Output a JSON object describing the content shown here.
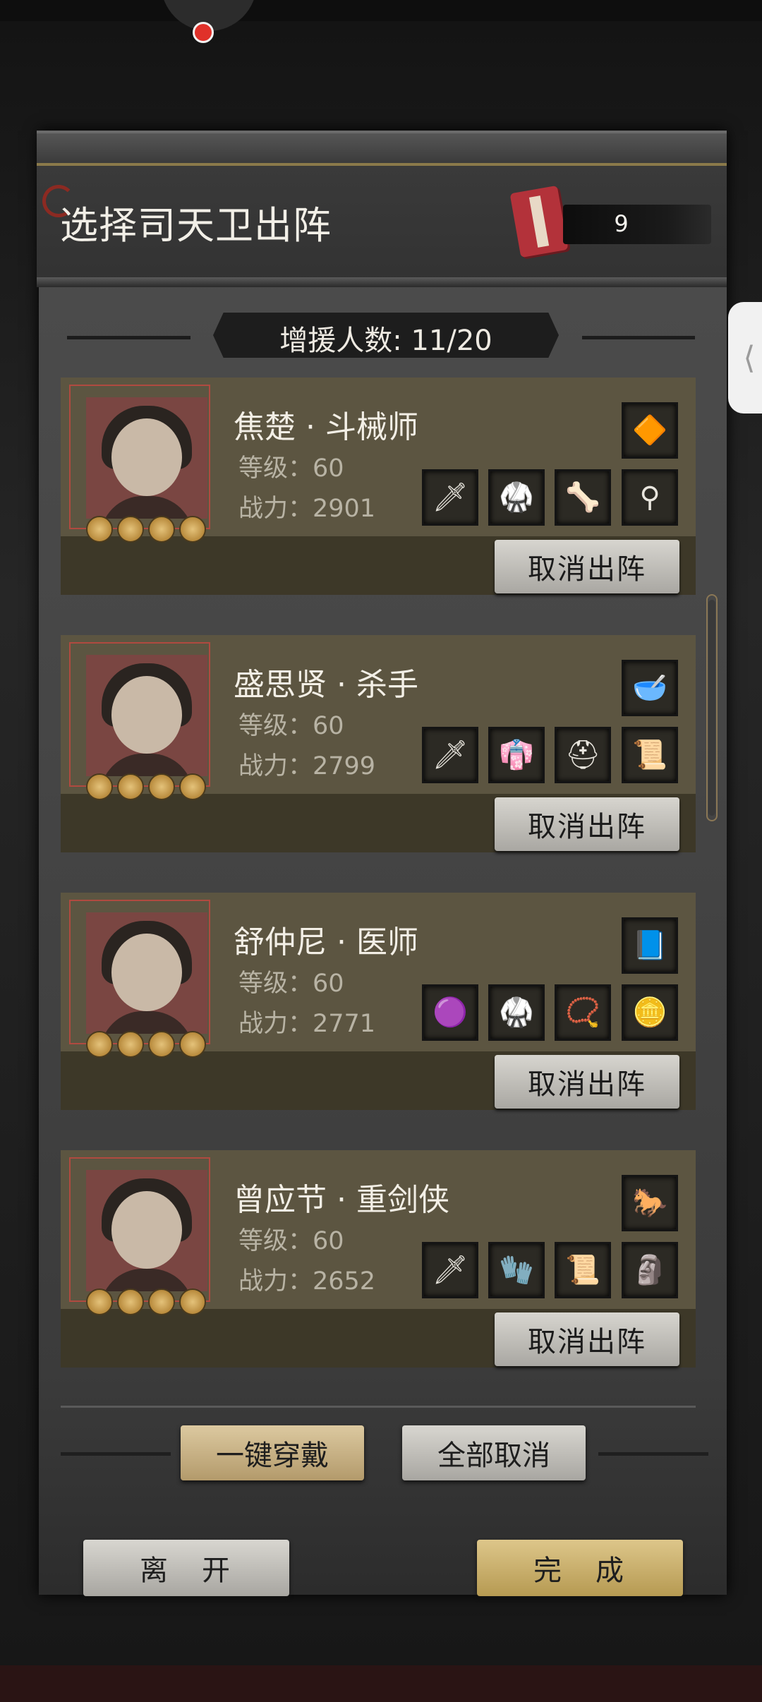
{
  "header": {
    "title": "选择司天卫出阵",
    "ticket_count": "9",
    "reinforce_label": "增援人数: 11/20"
  },
  "heroes": [
    {
      "name": "焦楚 · 斗械师",
      "level": "等级：60",
      "power": "战力：2901",
      "special_item": "amber-gem-icon",
      "equipment": [
        "dagger-icon",
        "armor-icon",
        "cudgel-icon",
        "pendant-icon"
      ],
      "action": "取消出阵"
    },
    {
      "name": "盛思贤 · 杀手",
      "level": "等级：60",
      "power": "战力：2799",
      "special_item": "jade-bowl-icon",
      "equipment": [
        "dagger-icon",
        "robe-icon",
        "helmet-icon",
        "talisman-icon"
      ],
      "action": "取消出阵"
    },
    {
      "name": "舒仲尼 · 医师",
      "level": "等级：60",
      "power": "战力：2771",
      "special_item": "book-icon",
      "equipment": [
        "gourd-icon",
        "armor-icon",
        "prayer-beads-icon",
        "medallion-icon"
      ],
      "action": "取消出阵"
    },
    {
      "name": "曾应节 · 重剑侠",
      "level": "等级：60",
      "power": "战力：2652",
      "special_item": "horse-icon",
      "equipment": [
        "sword-icon",
        "gauntlet-icon",
        "talisman-icon",
        "figurine-icon"
      ],
      "action": "取消出阵"
    }
  ],
  "footer": {
    "equip_all": "一键穿戴",
    "cancel_all": "全部取消",
    "leave": "离　开",
    "done": "完　成"
  },
  "icons": {
    "amber-gem-icon": "🔶",
    "jade-bowl-icon": "🥣",
    "book-icon": "📘",
    "horse-icon": "🐎",
    "dagger-icon": "🗡",
    "sword-icon": "🗡",
    "armor-icon": "🥋",
    "robe-icon": "👘",
    "helmet-icon": "⛑",
    "cudgel-icon": "🦴",
    "pendant-icon": "⚲",
    "talisman-icon": "📜",
    "gourd-icon": "🟣",
    "prayer-beads-icon": "📿",
    "medallion-icon": "🪙",
    "gauntlet-icon": "🧤",
    "figurine-icon": "🗿"
  },
  "colors": {
    "card_top": "#5c5541",
    "card_bottom": "#3d3828",
    "accent_red": "#b04a40",
    "gold_button": "#dcc9a0"
  }
}
